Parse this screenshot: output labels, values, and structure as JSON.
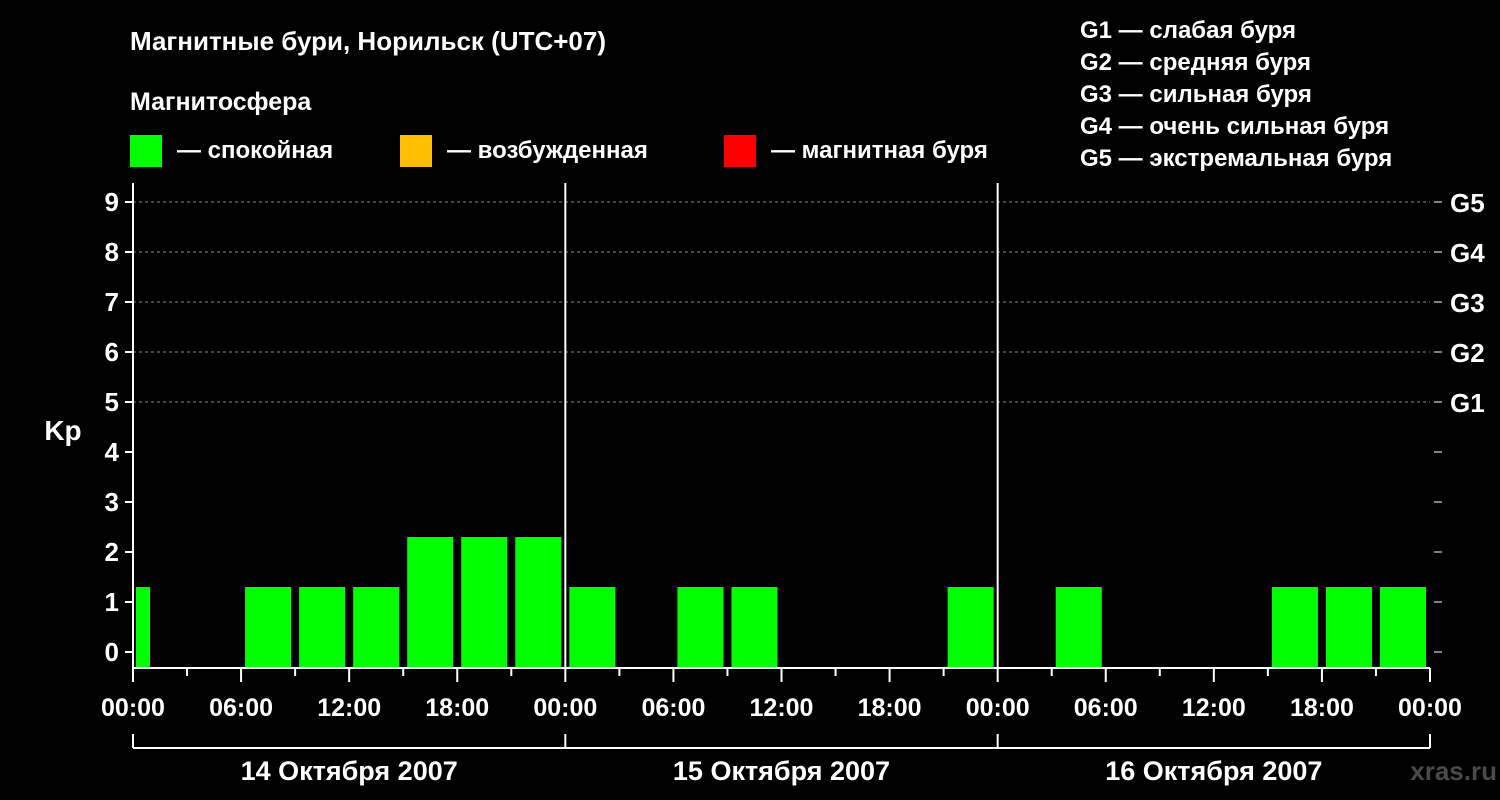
{
  "chart_data": {
    "type": "bar",
    "title": "Магнитные бури, Норильск (UTC+07)",
    "ylabel": "Kp",
    "ylim": [
      0,
      9
    ],
    "yticks": [
      "0",
      "1",
      "2",
      "3",
      "4",
      "5",
      "6",
      "7",
      "8",
      "9"
    ],
    "right_ticks": [
      {
        "value": 5,
        "label": "G1"
      },
      {
        "value": 6,
        "label": "G2"
      },
      {
        "value": 7,
        "label": "G3"
      },
      {
        "value": 8,
        "label": "G4"
      },
      {
        "value": 9,
        "label": "G5"
      }
    ],
    "legend_title": "Магнитосфера",
    "legend": [
      {
        "label": "— спокойная",
        "color": "#00ff00"
      },
      {
        "label": "— возбужденная",
        "color": "#ffbf00"
      },
      {
        "label": "— магнитная буря",
        "color": "#ff0000"
      }
    ],
    "storm_levels": [
      "G1 — слабая буря",
      "G2 — средняя буря",
      "G3 — сильная буря",
      "G4 — очень сильная буря",
      "G5 — экстремальная буря"
    ],
    "xtick_labels": [
      "00:00",
      "06:00",
      "12:00",
      "18:00",
      "00:00",
      "06:00",
      "12:00",
      "18:00",
      "00:00",
      "06:00",
      "12:00",
      "18:00",
      "00:00"
    ],
    "days": [
      "14 Октября 2007",
      "15 Октября 2007",
      "16 Октября 2007"
    ],
    "interval_hours": 3,
    "values": [
      1,
      null,
      1,
      1,
      1,
      2,
      2,
      2,
      1,
      null,
      1,
      1,
      null,
      null,
      null,
      1,
      null,
      1,
      null,
      null,
      null,
      1,
      1,
      1
    ],
    "watermark": "xras.ru"
  }
}
